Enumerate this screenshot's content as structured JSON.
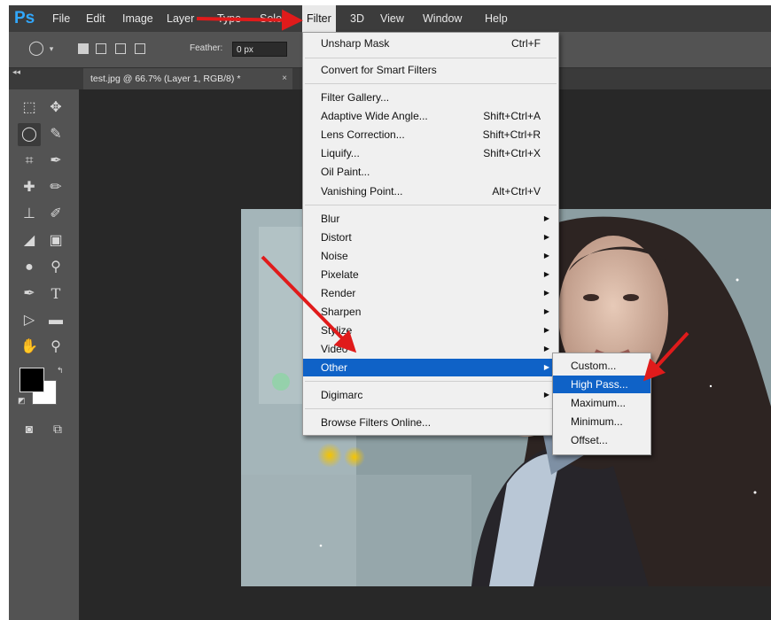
{
  "menubar": {
    "logo": "Ps",
    "items": [
      "File",
      "Edit",
      "Image",
      "Layer",
      "Type",
      "Select",
      "Filter",
      "3D",
      "View",
      "Window",
      "Help"
    ],
    "active": "Filter"
  },
  "options_bar": {
    "feather_label": "Feather:",
    "feather_value": "0 px"
  },
  "document_tab": {
    "title": "test.jpg @ 66.7% (Layer 1, RGB/8) *",
    "close": "×"
  },
  "filter_menu": {
    "items": [
      {
        "label": "Unsharp Mask",
        "shortcut": "Ctrl+F"
      },
      {
        "label": "Convert for Smart Filters"
      },
      {
        "label": "Filter Gallery..."
      },
      {
        "label": "Adaptive Wide Angle...",
        "shortcut": "Shift+Ctrl+A"
      },
      {
        "label": "Lens Correction...",
        "shortcut": "Shift+Ctrl+R"
      },
      {
        "label": "Liquify...",
        "shortcut": "Shift+Ctrl+X"
      },
      {
        "label": "Oil Paint..."
      },
      {
        "label": "Vanishing Point...",
        "shortcut": "Alt+Ctrl+V"
      },
      {
        "label": "Blur",
        "submenu": true
      },
      {
        "label": "Distort",
        "submenu": true
      },
      {
        "label": "Noise",
        "submenu": true
      },
      {
        "label": "Pixelate",
        "submenu": true
      },
      {
        "label": "Render",
        "submenu": true
      },
      {
        "label": "Sharpen",
        "submenu": true
      },
      {
        "label": "Stylize",
        "submenu": true
      },
      {
        "label": "Video",
        "submenu": true
      },
      {
        "label": "Other",
        "submenu": true,
        "highlighted": true
      },
      {
        "label": "Digimarc",
        "submenu": true
      },
      {
        "label": "Browse Filters Online..."
      }
    ],
    "submenu_arrow": "▶"
  },
  "other_submenu": {
    "items": [
      {
        "label": "Custom..."
      },
      {
        "label": "High Pass...",
        "highlighted": true
      },
      {
        "label": "Maximum..."
      },
      {
        "label": "Minimum..."
      },
      {
        "label": "Offset..."
      }
    ]
  },
  "colors": {
    "highlight": "#0f62c7",
    "annotation_arrow": "#e01b1b",
    "ps_logo": "#31a8ff"
  }
}
